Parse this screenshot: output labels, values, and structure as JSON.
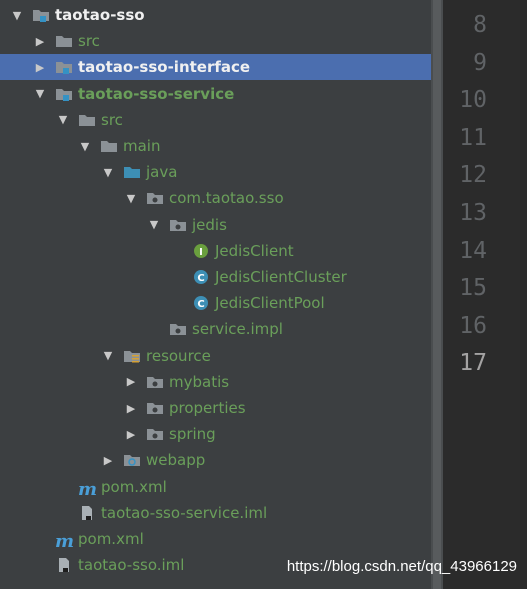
{
  "tree": [
    {
      "label": "taotao-sso",
      "icon": "module-folder-icon",
      "arrow": "expanded",
      "style": "white-bold"
    },
    {
      "label": "src",
      "icon": "folder-icon",
      "arrow": "collapsed",
      "style": "green"
    },
    {
      "label": "taotao-sso-interface",
      "icon": "module-folder-icon",
      "arrow": "collapsed",
      "style": "white-bold",
      "selected": true
    },
    {
      "label": "taotao-sso-service",
      "icon": "module-folder-icon",
      "arrow": "expanded",
      "style": "green-bold"
    },
    {
      "label": "src",
      "icon": "folder-icon",
      "arrow": "expanded",
      "style": "green"
    },
    {
      "label": "main",
      "icon": "folder-icon",
      "arrow": "expanded",
      "style": "green"
    },
    {
      "label": "java",
      "icon": "source-folder-icon",
      "arrow": "expanded",
      "style": "green"
    },
    {
      "label": "com.taotao.sso",
      "icon": "package-icon",
      "arrow": "expanded",
      "style": "green"
    },
    {
      "label": "jedis",
      "icon": "package-icon",
      "arrow": "expanded",
      "style": "green"
    },
    {
      "label": "JedisClient",
      "icon": "interface-icon",
      "arrow": "none",
      "style": "green"
    },
    {
      "label": "JedisClientCluster",
      "icon": "class-icon",
      "arrow": "none",
      "style": "green"
    },
    {
      "label": "JedisClientPool",
      "icon": "class-icon",
      "arrow": "none",
      "style": "green"
    },
    {
      "label": "service.impl",
      "icon": "package-icon",
      "arrow": "none",
      "style": "green"
    },
    {
      "label": "resource",
      "icon": "resource-folder-icon",
      "arrow": "expanded",
      "style": "green"
    },
    {
      "label": "mybatis",
      "icon": "package-icon",
      "arrow": "collapsed",
      "style": "green"
    },
    {
      "label": "properties",
      "icon": "package-icon",
      "arrow": "collapsed",
      "style": "green"
    },
    {
      "label": "spring",
      "icon": "package-icon",
      "arrow": "collapsed",
      "style": "green"
    },
    {
      "label": "webapp",
      "icon": "web-folder-icon",
      "arrow": "collapsed",
      "style": "green"
    },
    {
      "label": "pom.xml",
      "icon": "maven-icon",
      "arrow": "none",
      "style": "green"
    },
    {
      "label": "taotao-sso-service.iml",
      "icon": "iml-file-icon",
      "arrow": "none",
      "style": "green"
    },
    {
      "label": "pom.xml",
      "icon": "maven-icon",
      "arrow": "none",
      "style": "green"
    },
    {
      "label": "taotao-sso.iml",
      "icon": "iml-file-icon",
      "arrow": "none",
      "style": "green"
    }
  ],
  "line_numbers": [
    "8",
    "9",
    "10",
    "11",
    "12",
    "13",
    "14",
    "15",
    "16",
    "17"
  ],
  "current_line": "17",
  "watermark": "https://blog.csdn.net/qq_43966129",
  "colors": {
    "background": "#3c3f41",
    "selection": "#4b6eaf",
    "text_green": "#6a9f5a",
    "gutter": "#2b2b2b"
  }
}
